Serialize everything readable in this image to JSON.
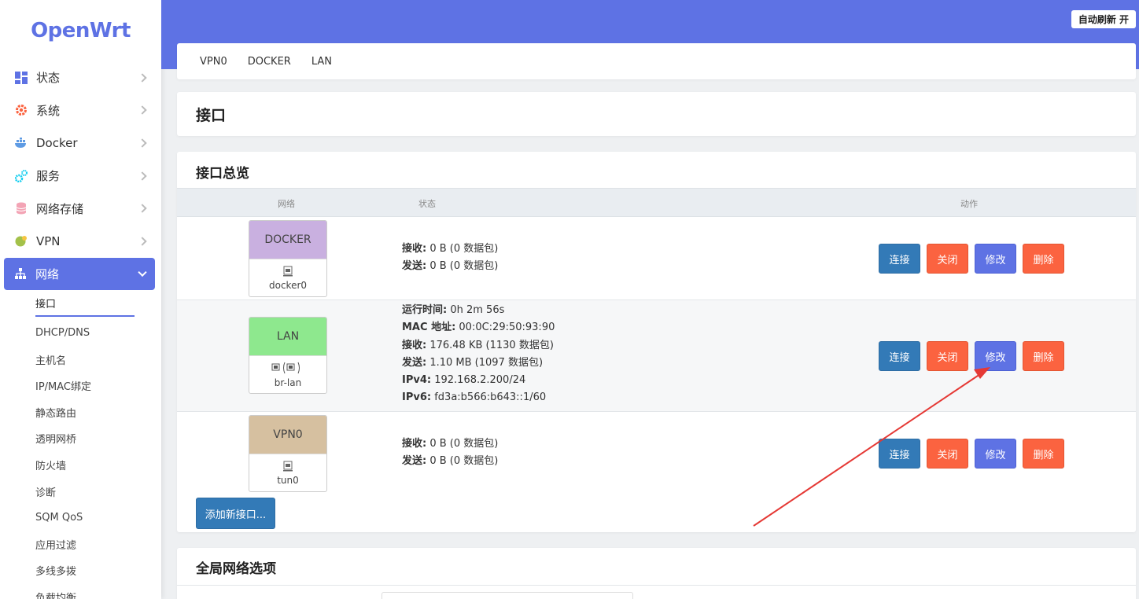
{
  "app": {
    "logo": "OpenWrt",
    "autorefresh": "自动刷新 开"
  },
  "sidebar": {
    "items": [
      {
        "label": "状态",
        "icon": "dashboard-icon",
        "color": "#5e72e4"
      },
      {
        "label": "系统",
        "icon": "gear-icon",
        "color": "#fb6340"
      },
      {
        "label": "Docker",
        "icon": "docker-icon",
        "color": "#5e9be4"
      },
      {
        "label": "服务",
        "icon": "services-icon",
        "color": "#11cdef"
      },
      {
        "label": "网络存储",
        "icon": "storage-icon",
        "color": "#f3a4b5"
      },
      {
        "label": "VPN",
        "icon": "vpn-icon",
        "color": "#a3c14a"
      },
      {
        "label": "网络",
        "icon": "network-icon",
        "color": "#ffffff"
      }
    ],
    "subitems": [
      "接口",
      "DHCP/DNS",
      "主机名",
      "IP/MAC绑定",
      "静态路由",
      "透明网桥",
      "防火墙",
      "诊断",
      "SQM QoS",
      "应用过滤",
      "多线多拨",
      "负载均衡"
    ]
  },
  "tabs": [
    "VPN0",
    "DOCKER",
    "LAN"
  ],
  "page_title": "接口",
  "overview": {
    "title": "接口总览",
    "headers": {
      "network": "网络",
      "status": "状态",
      "actions": "动作"
    },
    "rows": [
      {
        "name": "DOCKER",
        "device": "docker0",
        "color": "#c9b0e0",
        "status": [
          {
            "k": "接收:",
            "v": " 0 B (0 数据包)"
          },
          {
            "k": "发送:",
            "v": " 0 B (0 数据包)"
          }
        ]
      },
      {
        "name": "LAN",
        "device": "br-lan",
        "color": "#8ee88e",
        "status": [
          {
            "k": "运行时间:",
            "v": " 0h 2m 56s"
          },
          {
            "k": "MAC 地址:",
            "v": " 00:0C:29:50:93:90"
          },
          {
            "k": "接收:",
            "v": " 176.48 KB (1130 数据包)"
          },
          {
            "k": "发送:",
            "v": " 1.10 MB (1097 数据包)"
          },
          {
            "k": "IPv4:",
            "v": " 192.168.2.200/24"
          },
          {
            "k": "IPv6:",
            "v": " fd3a:b566:b643::1/60"
          }
        ]
      },
      {
        "name": "VPN0",
        "device": "tun0",
        "color": "#d6c0a0",
        "status": [
          {
            "k": "接收:",
            "v": " 0 B (0 数据包)"
          },
          {
            "k": "发送:",
            "v": " 0 B (0 数据包)"
          }
        ]
      }
    ],
    "buttons": {
      "connect": "连接",
      "close": "关闭",
      "edit": "修改",
      "delete": "删除"
    },
    "add_button": "添加新接口..."
  },
  "global": {
    "title": "全局网络选项"
  }
}
